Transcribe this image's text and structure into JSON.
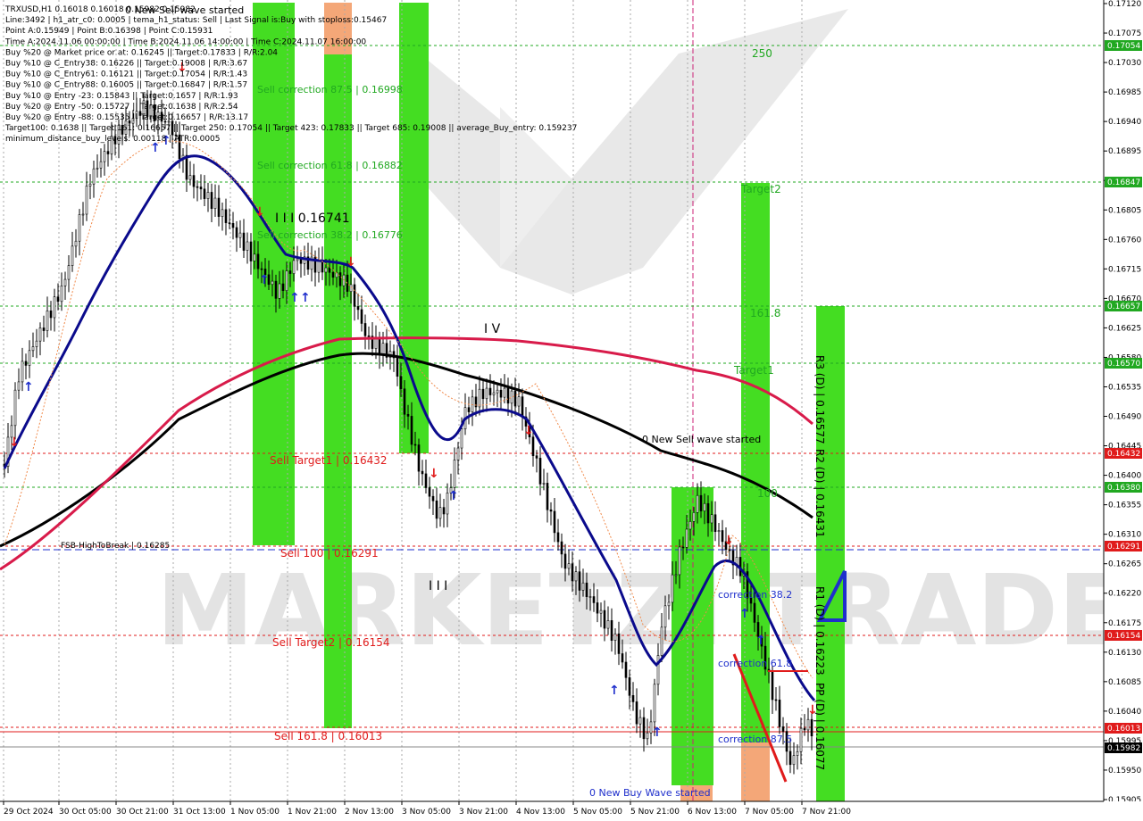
{
  "info_lines": [
    "TRXUSD,H1  0.16018 0.16018 0.15982 0.15982",
    "Line:3492 | h1_atr_c0: 0.0005 | tema_h1_status: Sell | Last Signal is:Buy with stoploss:0.15467",
    "Point A:0.15949 | Point B:0.16398 | Point C:0.15931",
    "Time A:2024.11.06 00:00:00 | Time B:2024.11.06 14:00:00 | Time C:2024.11.07 16:00:00",
    "Buy %20 @ Market price or at: 0.16245 || Target:0.17833 | R/R:2.04",
    "Buy %10 @ C_Entry38: 0.16226 || Target:0.19008 | R/R:3.67",
    "Buy %10 @ C_Entry61: 0.16121 || Target:0.17054 | R/R:1.43",
    "Buy %10 @ C_Entry88: 0.16005 || Target:0.16847 | R/R:1.57",
    "Buy %10 @ Entry -23: 0.15843 || Target:0.1657 | R/R:1.93",
    "Buy %20 @ Entry -50: 0.15727 || Target:0.1638 | R/R:2.54",
    "Buy %20 @ Entry -88: 0.15535 || Target:0.16657 | R/R:13.17",
    "Target100: 0.1638 || Target 161: 0.16657 || Target 250: 0.17054 || Target 423: 0.17833 || Target 685: 0.19008 || average_Buy_entry: 0.159237",
    "minimum_distance_buy_levels: 0.00118 | ATR:0.0005"
  ],
  "top_label": "0 New Sell wave started",
  "price_axis": [
    "0.17120",
    "0.17075",
    "0.17030",
    "0.16985",
    "0.16940",
    "0.16895",
    "0.16850",
    "0.16805",
    "0.16760",
    "0.16715",
    "0.16670",
    "0.16625",
    "0.16580",
    "0.16535",
    "0.16490",
    "0.16445",
    "0.16400",
    "0.16355",
    "0.16310",
    "0.16265",
    "0.16220",
    "0.16175",
    "0.16130",
    "0.16085",
    "0.16040",
    "0.15995",
    "0.15950",
    "0.15905"
  ],
  "time_axis": [
    "29 Oct 2024",
    "30 Oct 05:00",
    "30 Oct 21:00",
    "31 Oct 13:00",
    "1 Nov 05:00",
    "1 Nov 21:00",
    "2 Nov 13:00",
    "3 Nov 05:00",
    "3 Nov 21:00",
    "4 Nov 13:00",
    "5 Nov 05:00",
    "5 Nov 21:00",
    "6 Nov 13:00",
    "7 Nov 05:00",
    "7 Nov 21:00"
  ],
  "level_tags": [
    {
      "text": "0.17054",
      "color": "#21a821"
    },
    {
      "text": "0.16847",
      "color": "#21a821"
    },
    {
      "text": "0.16657",
      "color": "#21a821"
    },
    {
      "text": "0.16570",
      "color": "#21a821"
    },
    {
      "text": "0.16432",
      "color": "#e01b1b"
    },
    {
      "text": "0.16380",
      "color": "#21a821"
    },
    {
      "text": "0.16291",
      "color": "#e01b1b"
    },
    {
      "text": "0.16154",
      "color": "#e01b1b"
    },
    {
      "text": "0.16013",
      "color": "#e01b1b"
    },
    {
      "text": "0.15982",
      "color": "#000000"
    }
  ],
  "annotations": {
    "sell_correction_875": "Sell correction 87.5 | 0.16998",
    "sell_correction_618": "Sell correction 61.8 | 0.16882",
    "sell_correction_382": "Sell correction 38.2 | 0.16776",
    "wave_iii_price": "I I I 0.16741",
    "sell_target1": "Sell Target1 | 0.16432",
    "sell_100": "Sell 100 | 0.16291",
    "sell_target2": "Sell Target2 | 0.16154",
    "sell_1618": "Sell 161.8 | 0.16013",
    "fsb": "FSB-HighToBreak | 0.16285",
    "lvl_250": "250",
    "target2": "Target2",
    "lvl_1618": "161.8",
    "target1": "Target1",
    "lvl_100": "100",
    "wave_iv": "I V",
    "wave_iii": "I I I",
    "new_sell_wave": "0 New Sell wave started",
    "new_buy_wave": "0 New Buy Wave started",
    "correction_382": "correction 38.2",
    "correction_618": "correction 61.8",
    "correction_875": "correction 87.5",
    "r3": "R3 (D) | 0.16577",
    "r2": "R2 (D) | 0.16431",
    "r1": "R1 (D) | 0.16223",
    "pp": "PP (D) | 0.16077"
  },
  "watermark": "MARKETZI TRADE",
  "colors": {
    "green": "#21a821",
    "bright_green": "#44dd22",
    "red": "#e01b1b",
    "blue": "#1f2fcc",
    "navy": "#0a0a8c",
    "crimson": "#d81b4a",
    "orange": "#f08a4b"
  }
}
